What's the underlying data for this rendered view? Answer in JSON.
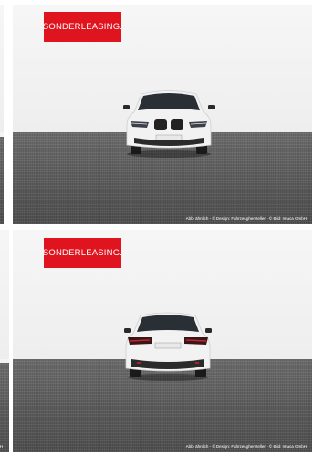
{
  "slides": [
    {
      "badge": "SONDERLEASING.",
      "credit": "Abb. ähnlich - © Design: Fahrzeughersteller - © Bild: Imaca GmbH",
      "view": "front-view"
    },
    {
      "badge": "SONDERLEASING.",
      "credit": "Abb. ähnlich - © Design: Fahrzeughersteller - © Bild: Imaca GmbH",
      "view": "rear-view"
    }
  ],
  "peek_credit": "H",
  "colors": {
    "badge_bg": "#e0141e",
    "badge_text": "#ffffff",
    "wall": "#f4f4f4",
    "floor": "#5a5a5a"
  }
}
